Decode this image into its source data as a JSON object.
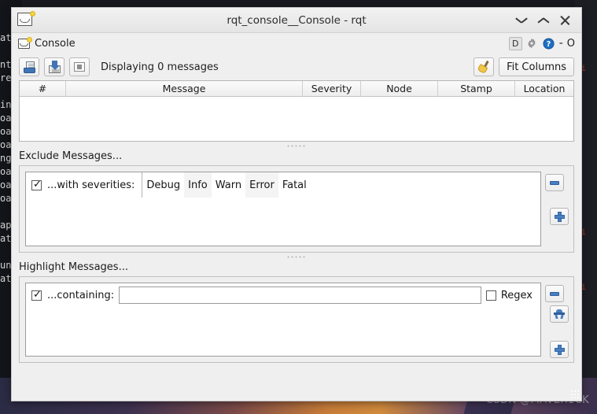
{
  "window": {
    "title": "rqt_console__Console - rqt",
    "icon": "envelope-icon",
    "controls": {
      "minimize": "⌄",
      "maximize": "⌃",
      "close": "✕"
    }
  },
  "dock": {
    "title": "Console",
    "icon": "envelope-icon",
    "buttons": {
      "d": "D",
      "settings": "gear-icon",
      "help": "?",
      "dash": "-",
      "float": "O"
    }
  },
  "toolbar": {
    "open_icon": "open-file-icon",
    "save_icon": "save-file-icon",
    "pause_icon": "pause-icon",
    "status": "Displaying 0 messages",
    "broom_icon": "broom-icon",
    "fit_columns_label": "Fit Columns"
  },
  "message_table": {
    "columns": [
      "#",
      "Message",
      "Severity",
      "Node",
      "Stamp",
      "Location"
    ],
    "rows": []
  },
  "exclude": {
    "section_label": "Exclude Messages...",
    "rule": {
      "enabled": true,
      "label": "...with severities:",
      "severities": [
        "Debug",
        "Info",
        "Warn",
        "Error",
        "Fatal"
      ]
    },
    "remove_label": "minus-icon",
    "add_label": "plus-icon"
  },
  "highlight": {
    "section_label": "Highlight Messages...",
    "rule": {
      "enabled": true,
      "label": "...containing:",
      "value": "",
      "placeholder": "",
      "regex_label": "Regex",
      "regex_checked": false
    },
    "remove_label": "minus-icon",
    "table_label": "highlight-table-icon",
    "add_label": "plus-icon"
  },
  "desktop": {
    "watermark": "CSDN @MAVER1CK",
    "terminal_left": "輯\nat\n\nnt\nre\n\nin\noa\noa\noa\nng\noa\noa\noa\n\nap\nat\n\nun\nat",
    "terminal_right": [
      "hi",
      "hi",
      "hi"
    ]
  },
  "colors": {
    "accent_blue": "#4a7fc0",
    "window_bg": "#efefef",
    "titlebar_bg": "#ececec",
    "border": "#b7b7b7",
    "terminal_red": "#a33a2c",
    "terminal_green": "#4e9a5a"
  }
}
